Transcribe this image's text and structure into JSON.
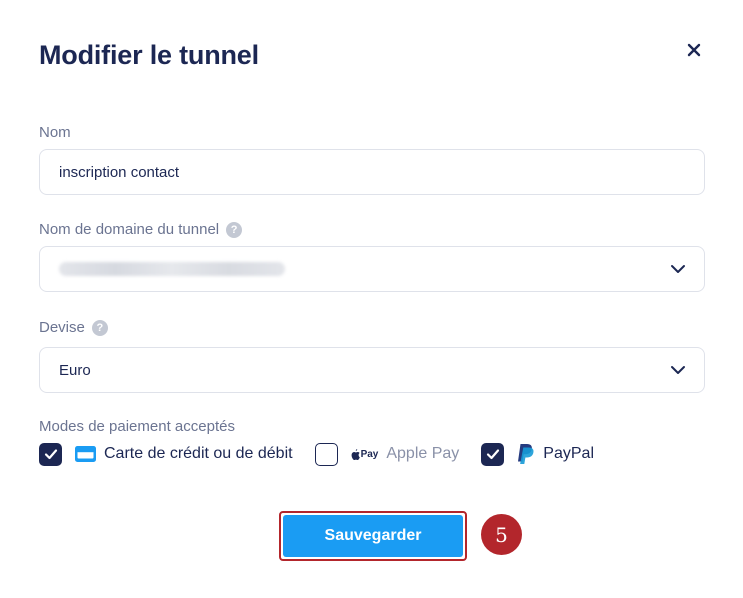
{
  "modal": {
    "title": "Modifier le tunnel"
  },
  "form": {
    "name": {
      "label": "Nom",
      "value": "inscription contact"
    },
    "domain": {
      "label": "Nom de domaine du tunnel",
      "help": "?"
    },
    "currency": {
      "label": "Devise",
      "help": "?",
      "value": "Euro"
    },
    "payments": {
      "label": "Modes de paiement acceptés",
      "options": [
        {
          "label": "Carte de crédit ou de débit",
          "checked": true,
          "icon": "credit-card-icon"
        },
        {
          "label": "Apple Pay",
          "icon_text": "Pay",
          "checked": false,
          "icon": "apple-pay-icon"
        },
        {
          "label": "PayPal",
          "checked": true,
          "icon": "paypal-icon"
        }
      ]
    }
  },
  "actions": {
    "save_label": "Sauvegarder"
  },
  "annotation": {
    "step": "5"
  },
  "colors": {
    "primary_text": "#1c2753",
    "accent_button": "#1a9cf3",
    "annotation_red": "#b3262c",
    "card_icon": "#1a9cf3",
    "paypal_dark": "#253b80",
    "paypal_light": "#179bd7"
  }
}
